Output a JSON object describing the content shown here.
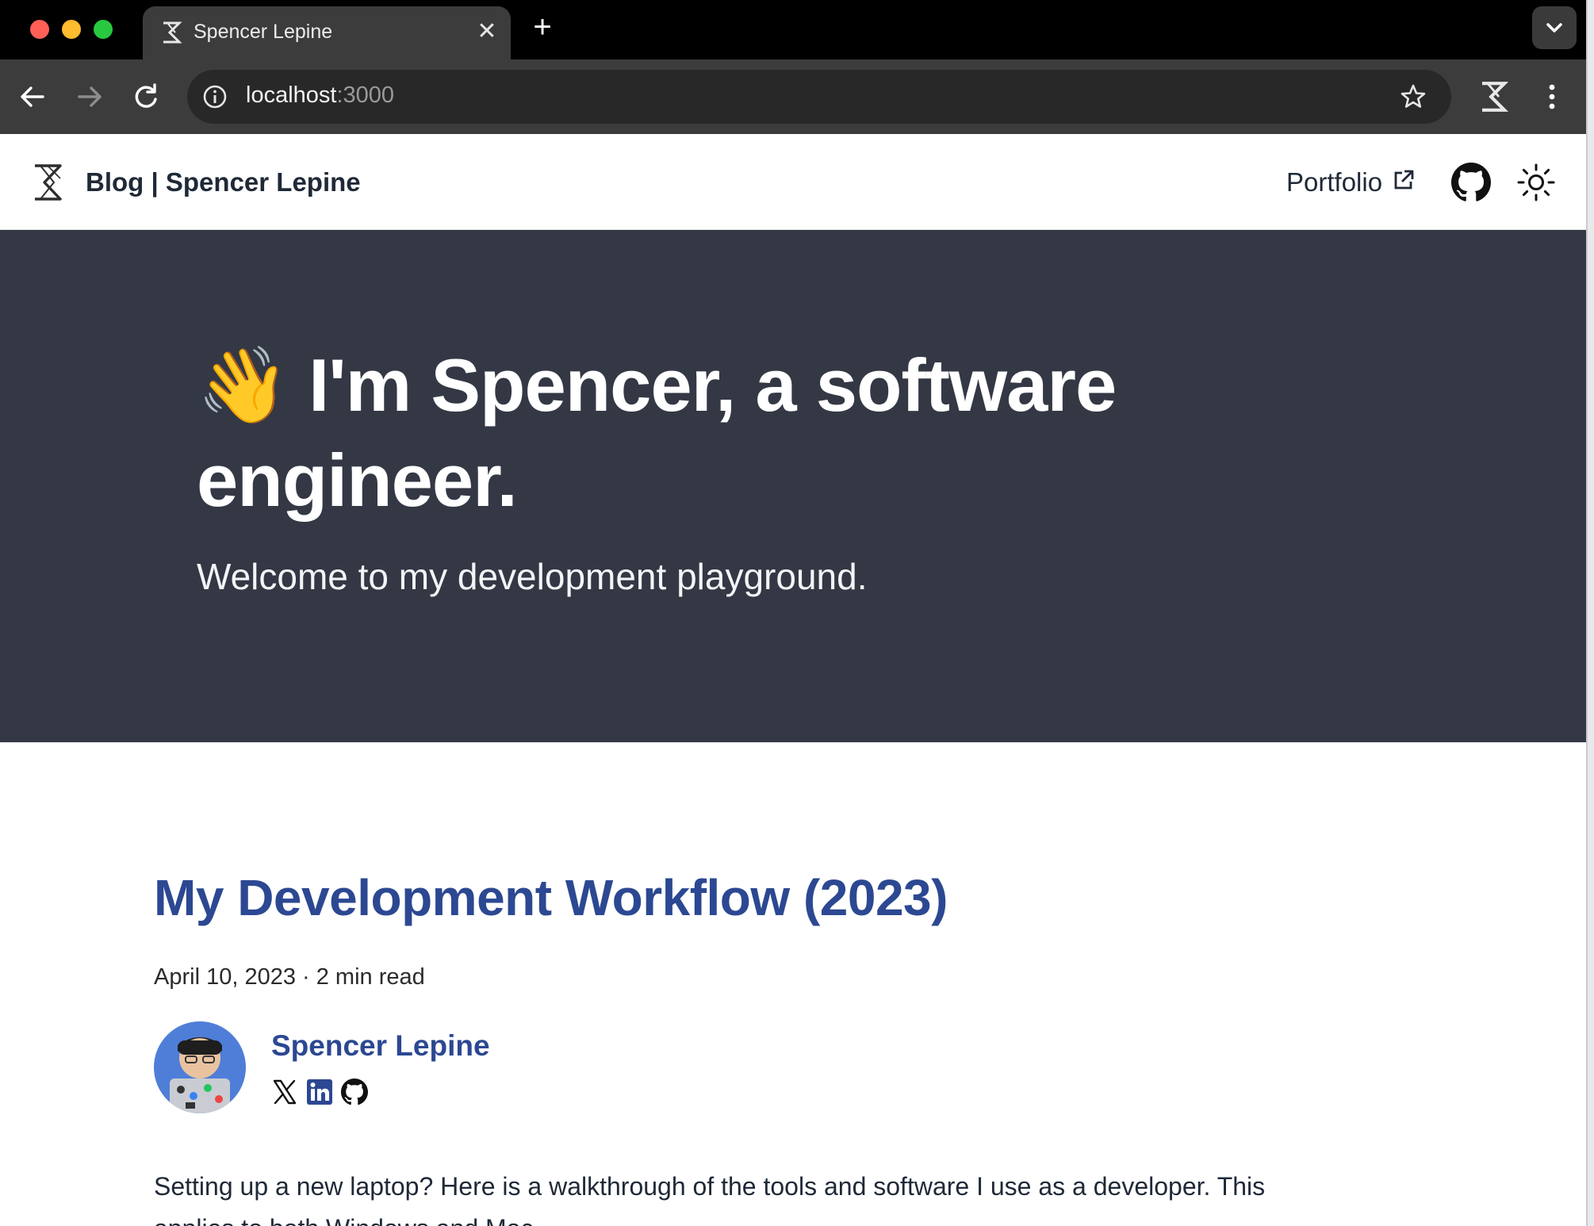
{
  "browser": {
    "tab_title": "Spencer Lepine",
    "tab_close": "✕",
    "new_tab": "+",
    "url_host": "localhost",
    "url_port": ":3000"
  },
  "site": {
    "title": "Blog | Spencer Lepine",
    "nav_portfolio": "Portfolio"
  },
  "hero": {
    "emoji": "👋",
    "heading": "I'm Spencer, a software engineer.",
    "subheading": "Welcome to my development playground."
  },
  "post": {
    "title": "My Development Workflow (2023)",
    "meta": "April 10, 2023 · 2 min read",
    "author": "Spencer Lepine",
    "excerpt": "Setting up a new laptop? Here is a walkthrough of the tools and software I use as a developer. This applies to both Windows and Mac."
  },
  "icons": {
    "back": "arrow-left-icon",
    "forward": "arrow-right-icon",
    "reload": "reload-icon",
    "info": "info-icon",
    "bookmark": "star-icon",
    "menu": "kebab-menu-icon",
    "theme": "sun-icon",
    "github": "github-icon",
    "x": "x-icon",
    "linkedin": "linkedin-icon"
  },
  "colors": {
    "hero_bg": "#343845",
    "link_blue": "#2c4892",
    "text_dark": "#1f2937"
  }
}
